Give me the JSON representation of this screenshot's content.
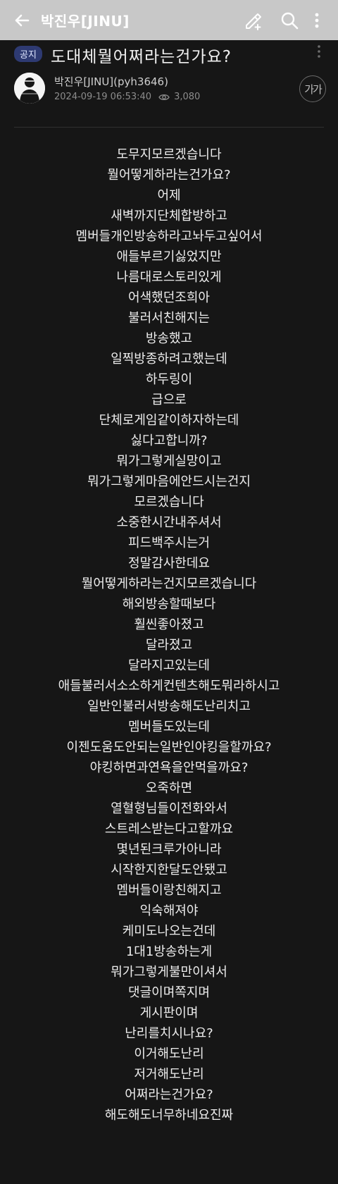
{
  "topbar": {
    "title": "박진우[JINU]",
    "icons": [
      "back-arrow-icon",
      "pencil-plus-icon",
      "search-icon",
      "more-vertical-icon"
    ]
  },
  "post": {
    "badge": "공지",
    "title": "도대체뭘어쩌라는건가요?",
    "author": "박진우[JINU](pyh3646)",
    "datetime": "2024-09-19 06:53:40",
    "views": "3,080",
    "font_button": "가가"
  },
  "content": {
    "lines": [
      "도무지모르겠습니다",
      "뭘어떻게하라는건가요?",
      "어제",
      "새벽까지단체합방하고",
      "멤버들개인방송하라고놔두고싶어서",
      "애들부르기싫었지만",
      "나름대로스토리있게",
      "어색했던조희아",
      "불러서친해지는",
      "방송했고",
      "일찍방종하려고했는데",
      "하두링이",
      "급으로",
      "단체로게임같이하자하는데",
      "싫다고합니까?",
      "뭐가그렇게실망이고",
      "뭐가그렇게마음에안드시는건지",
      "모르겠습니다",
      "소중한시간내주셔서",
      "피드백주시는거",
      "정말감사한데요",
      "뭘어떻게하라는건지모르겠습니다",
      "해외방송할때보다",
      "훨씬좋아졌고",
      "달라졌고",
      "달라지고있는데",
      "애들불러서소소하게컨텐츠해도뭐라하시고",
      "일반인불러서방송해도난리치고",
      "멤버들도있는데",
      "이젠도움도안되는일반인야킹을할까요?",
      "야킹하면과연욕을안먹을까요?",
      "오죽하면",
      "열혈형님들이전화와서",
      "스트레스받는다고할까요",
      "몇년된크루가아니라",
      "시작한지한달도안됐고",
      "멤버들이랑친해지고",
      "익숙해져야",
      "케미도나오는건데",
      "1대1방송하는게",
      "뭐가그렇게불만이셔서",
      "댓글이며쪽지며",
      "게시판이며",
      "난리를치시나요?",
      "이거해도난리",
      "저거해도난리",
      "어쩌라는건가요?",
      "해도해도너무하네요진짜"
    ]
  }
}
